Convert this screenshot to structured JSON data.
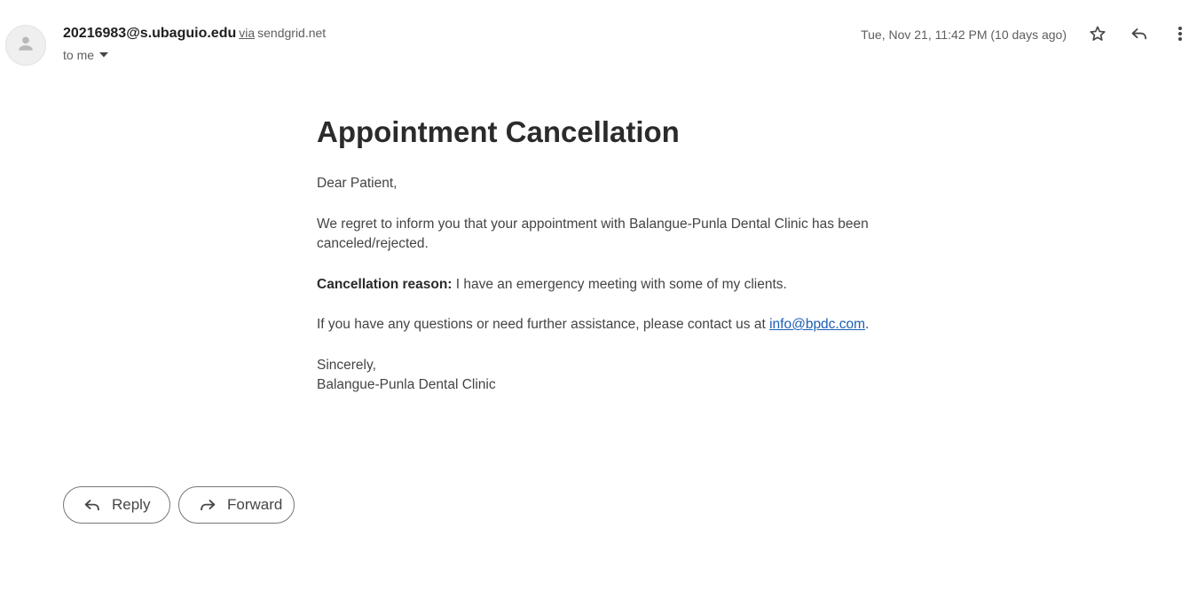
{
  "header": {
    "sender_email": "20216983@s.ubaguio.edu",
    "via_label": "via",
    "via_domain": "sendgrid.net",
    "recipient": "to me",
    "date": "Tue, Nov 21, 11:42 PM (10 days ago)",
    "icons": [
      "avatar-person-icon",
      "chevron-down-icon",
      "star-icon",
      "reply-icon",
      "more-vertical-icon"
    ]
  },
  "email": {
    "title": "Appointment Cancellation",
    "greeting": "Dear Patient,",
    "body_line": "We regret to inform you that your appointment with Balangue-Punla Dental Clinic has been canceled/rejected.",
    "reason_label": "Cancellation reason:",
    "reason_text": " I have an emergency meeting with some of my clients.",
    "contact_prefix": "If you have any questions or need further assistance, please contact us at ",
    "contact_email": "info@bpdc.com",
    "contact_suffix": ".",
    "closing": "Sincerely,",
    "signature": "Balangue-Punla Dental Clinic"
  },
  "actions": {
    "reply_label": "Reply",
    "forward_label": "Forward"
  },
  "colors": {
    "link": "#1a5fb4",
    "text": "#444444",
    "title": "#2b2b2b"
  }
}
